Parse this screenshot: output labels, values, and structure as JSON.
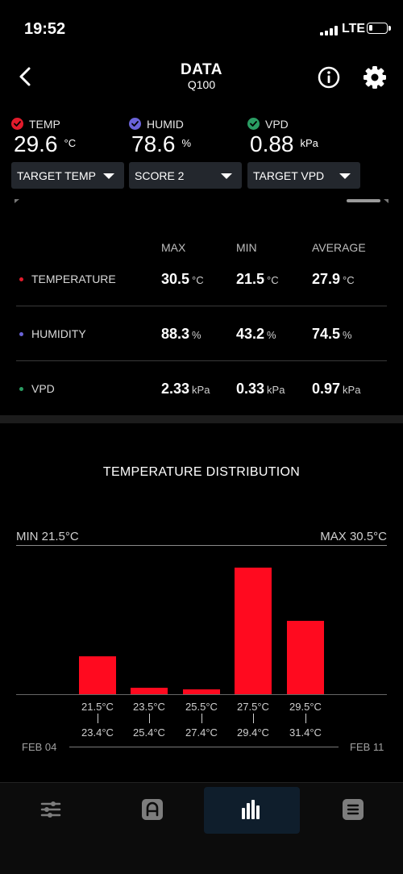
{
  "status_bar": {
    "time": "19:52",
    "network": "LTE",
    "battery_level": 0.2
  },
  "header": {
    "title": "DATA",
    "subtitle": "Q100"
  },
  "readouts": [
    {
      "label": "TEMP",
      "value": "29.6",
      "unit": "°C",
      "color": "#e21b2b"
    },
    {
      "label": "HUMID",
      "value": "78.6",
      "unit": "%",
      "color": "#6a63d8"
    },
    {
      "label": "VPD",
      "value": "0.88",
      "unit": "kPa",
      "color": "#2a9d63"
    }
  ],
  "selectors": [
    {
      "label": "TARGET TEMP"
    },
    {
      "label": "SCORE 2"
    },
    {
      "label": "TARGET VPD"
    }
  ],
  "stats": {
    "columns": [
      "MAX",
      "MIN",
      "AVERAGE"
    ],
    "rows": [
      {
        "label": "TEMPERATURE",
        "color": "#e21b2b",
        "unit": "°C",
        "max": "30.5",
        "min": "21.5",
        "avg": "27.9"
      },
      {
        "label": "HUMIDITY",
        "color": "#6a63d8",
        "unit": "%",
        "max": "88.3",
        "min": "43.2",
        "avg": "74.5"
      },
      {
        "label": "VPD",
        "color": "#2a9d63",
        "unit": "kPa",
        "max": "2.33",
        "min": "0.33",
        "avg": "0.97"
      }
    ]
  },
  "distribution": {
    "title": "TEMPERATURE DISTRIBUTION",
    "min_label": "MIN 21.5°C",
    "max_label": "MAX 30.5°C",
    "start_date": "FEB 04",
    "end_date": "FEB 11",
    "bar_color": "#ff0a1f"
  },
  "chart_data": {
    "type": "bar",
    "title": "TEMPERATURE DISTRIBUTION",
    "categories": [
      {
        "from": "21.5°C",
        "to": "23.4°C"
      },
      {
        "from": "23.5°C",
        "to": "25.4°C"
      },
      {
        "from": "25.5°C",
        "to": "27.4°C"
      },
      {
        "from": "27.5°C",
        "to": "29.4°C"
      },
      {
        "from": "29.5°C",
        "to": "31.4°C"
      }
    ],
    "values": [
      0.3,
      0.05,
      0.04,
      1.0,
      0.58
    ],
    "ylim": [
      0,
      1
    ],
    "grid": false
  },
  "nav": {
    "items": [
      {
        "name": "sliders-icon"
      },
      {
        "name": "gauge-icon"
      },
      {
        "name": "bar-chart-icon",
        "active": true
      },
      {
        "name": "list-icon"
      }
    ],
    "accent": "#0f1e2c"
  }
}
